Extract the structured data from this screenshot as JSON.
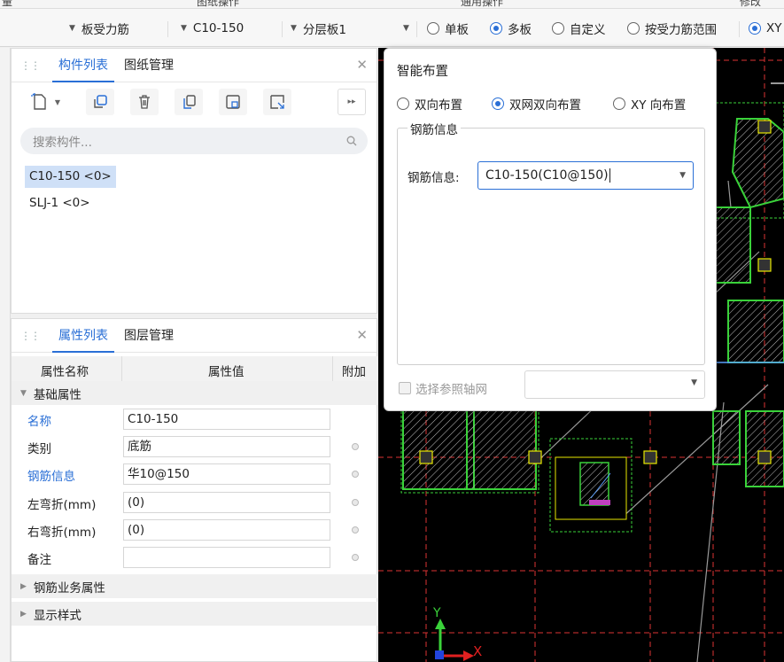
{
  "top_strip": {
    "left": "量",
    "mid1": "图纸操作",
    "mid2": "通用操作",
    "right": "修改"
  },
  "toolbar": {
    "dropdown1": "板受力筋",
    "dropdown2": "C10-150",
    "dropdown3": "分层板1",
    "radios": [
      {
        "label": "单板",
        "checked": false
      },
      {
        "label": "多板",
        "checked": true
      },
      {
        "label": "自定义",
        "checked": false
      },
      {
        "label": "按受力筋范围",
        "checked": false
      },
      {
        "label": "XY",
        "checked": true
      }
    ]
  },
  "component_panel": {
    "tabs": [
      "构件列表",
      "图纸管理"
    ],
    "active_tab": 0,
    "search_placeholder": "搜索构件...",
    "items": [
      {
        "label": "C10-150 <0>",
        "selected": true
      },
      {
        "label": "SLJ-1 <0>",
        "selected": false
      }
    ]
  },
  "property_panel": {
    "tabs": [
      "属性列表",
      "图层管理"
    ],
    "active_tab": 0,
    "headers": {
      "name": "属性名称",
      "value": "属性值",
      "extra": "附加"
    },
    "group_basic": "基础属性",
    "rows": [
      {
        "label": "名称",
        "value": "C10-150",
        "blue": true,
        "dot": false
      },
      {
        "label": "类别",
        "value": "底筋",
        "blue": false,
        "dot": true
      },
      {
        "label": "钢筋信息",
        "value": "华10@150",
        "blue": true,
        "dot": true
      },
      {
        "label": "左弯折(mm)",
        "value": "(0)",
        "blue": false,
        "dot": true
      },
      {
        "label": "右弯折(mm)",
        "value": "(0)",
        "blue": false,
        "dot": true
      },
      {
        "label": "备注",
        "value": "",
        "blue": false,
        "dot": true
      }
    ],
    "group_business": "钢筋业务属性",
    "group_display": "显示样式"
  },
  "popup": {
    "title": "智能布置",
    "radios": [
      {
        "label": "双向布置",
        "checked": false
      },
      {
        "label": "双网双向布置",
        "checked": true
      },
      {
        "label": "XY 向布置",
        "checked": false
      }
    ],
    "group_legend": "钢筋信息",
    "field_label": "钢筋信息:",
    "field_value": "C10-150(C10@150)",
    "checkbox_label": "选择参照轴网",
    "checkbox_checked": false,
    "axis_select_value": ""
  },
  "canvas": {
    "axis_x": "X",
    "axis_y": "Y"
  },
  "colors": {
    "accent": "#2a6fd6",
    "cad_green": "#3ad23a",
    "cad_bg": "#000000",
    "axis_red": "#e02020"
  }
}
